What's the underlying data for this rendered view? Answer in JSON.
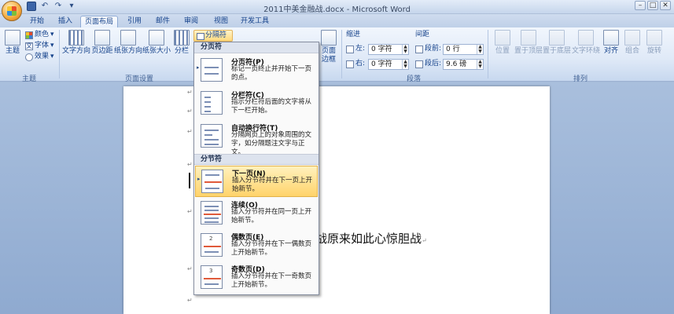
{
  "window": {
    "title": "2011中美金融战.docx - Microsoft Word",
    "qat": [
      "save-icon",
      "undo-icon",
      "redo-icon",
      "customize-icon"
    ],
    "win_buttons": [
      "–",
      "□",
      "✕"
    ]
  },
  "tabs": [
    "开始",
    "插入",
    "页面布局",
    "引用",
    "邮件",
    "审阅",
    "视图",
    "开发工具"
  ],
  "ribbon": {
    "theme": {
      "big": "主题",
      "colors": "颜色",
      "fonts": "字体",
      "effects": "效果",
      "group": "主题"
    },
    "page_setup": {
      "text_dir": "文字方向",
      "margins": "页边距",
      "orientation": "纸张方向",
      "size": "纸张大小",
      "columns": "分栏",
      "group": "页面设置"
    },
    "breaks_btn": "分隔符",
    "page_bg": {
      "border": "页面\n边框"
    },
    "paragraph": {
      "indent_label": "缩进",
      "left_label": "左:",
      "left_value": "0 字符",
      "right_label": "右:",
      "right_value": "0 字符",
      "spacing_label": "间距",
      "before_label": "段前:",
      "before_value": "0 行",
      "after_label": "段后:",
      "after_value": "9.6 磅",
      "group": "段落"
    },
    "arrange": {
      "position": "位置",
      "front": "置于顶层",
      "back": "置于底层",
      "wrap": "文字环绕",
      "align": "对齐",
      "group_btn": "组合",
      "rotate": "旋转",
      "group": "排列"
    }
  },
  "menu": {
    "page_breaks_header": "分页符",
    "section_breaks_header": "分节符",
    "items": [
      {
        "title": "分页符(P)",
        "desc": "标记一页终止并开始下一页的点。"
      },
      {
        "title": "分栏符(C)",
        "desc": "指示分栏符后面的文字将从下一栏开始。"
      },
      {
        "title": "自动换行符(T)",
        "desc": "分隔网页上的对象周围的文字，如分隔题注文字与正文。"
      },
      {
        "title": "下一页(N)",
        "desc": "插入分节符并在下一页上开始新节。"
      },
      {
        "title": "连续(O)",
        "desc": "插入分节符并在同一页上开始新节。"
      },
      {
        "title": "偶数页(E)",
        "desc": "插入分节符并在下一偶数页上开始新节。",
        "num": "2"
      },
      {
        "title": "奇数页(D)",
        "desc": "插入分节符并在下一奇数页上开始新节。",
        "num": "3"
      }
    ]
  },
  "document": {
    "visible_text": "战原来如此心惊胆战",
    "para_mark": "↵"
  }
}
